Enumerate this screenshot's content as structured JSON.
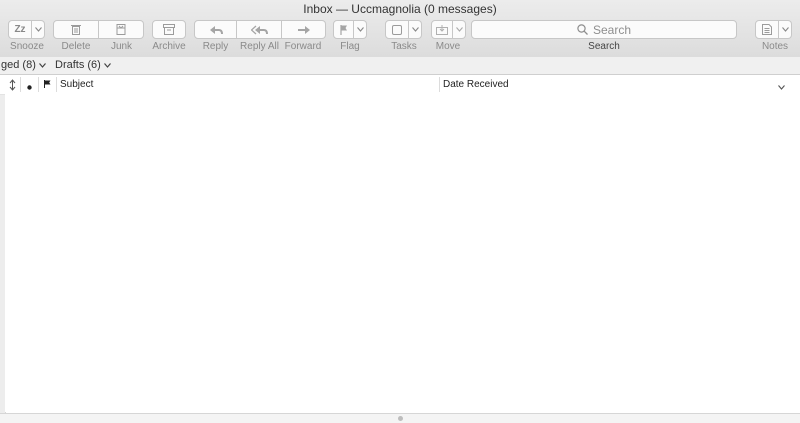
{
  "window": {
    "title": "Inbox — Uccmagnolia (0 messages)"
  },
  "toolbar": {
    "snooze": {
      "label": "Snooze",
      "icon": "snooze-icon",
      "glyph": "Zz"
    },
    "delete": {
      "label": "Delete",
      "icon": "trash-icon"
    },
    "junk": {
      "label": "Junk",
      "icon": "junk-icon"
    },
    "archive": {
      "label": "Archive",
      "icon": "archive-icon"
    },
    "reply": {
      "label": "Reply",
      "icon": "reply-icon"
    },
    "reply_all": {
      "label": "Reply All",
      "icon": "reply-all-icon"
    },
    "forward": {
      "label": "Forward",
      "icon": "forward-icon"
    },
    "flag": {
      "label": "Flag",
      "icon": "flag-icon"
    },
    "tasks": {
      "label": "Tasks",
      "icon": "checkbox-icon"
    },
    "move": {
      "label": "Move",
      "icon": "move-icon"
    },
    "search": {
      "label": "Search",
      "placeholder": "Search",
      "icon": "search-icon"
    },
    "notes": {
      "label": "Notes",
      "icon": "notes-icon"
    }
  },
  "favorites": [
    {
      "label": "ged (8)"
    },
    {
      "label": "Drafts (6)"
    }
  ],
  "columns": {
    "subject": "Subject",
    "date_received": "Date Received"
  },
  "colors": {
    "toolbar_bg": "#dcdcdc",
    "text_muted": "#8a8a8a"
  }
}
